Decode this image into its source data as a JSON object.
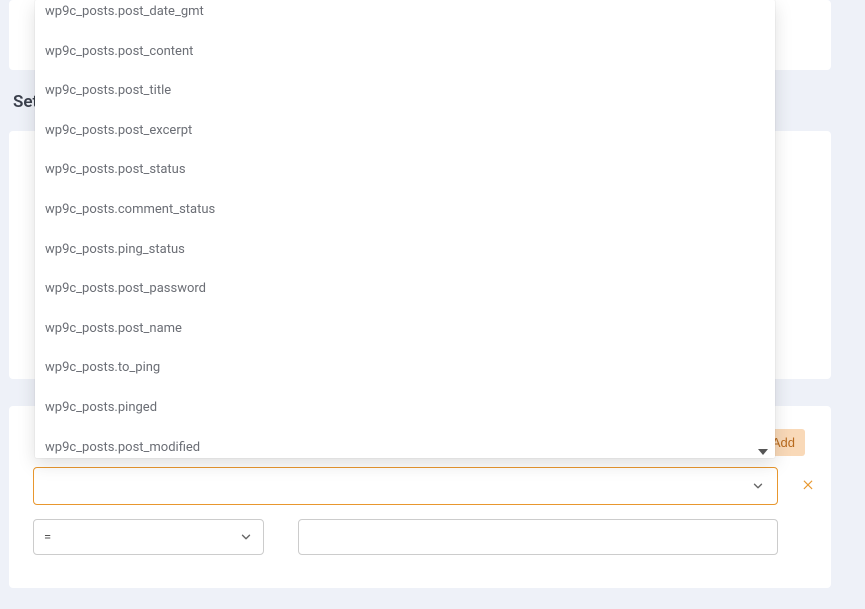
{
  "sectionLabel": "Set",
  "addButton": {
    "label": "Add"
  },
  "combo": {
    "value": ""
  },
  "operator": {
    "value": "="
  },
  "valueField": {
    "value": "",
    "placeholder": ""
  },
  "dropdown": {
    "items": [
      {
        "label": "wp9c_posts.post_date_gmt"
      },
      {
        "label": "wp9c_posts.post_content"
      },
      {
        "label": "wp9c_posts.post_title"
      },
      {
        "label": "wp9c_posts.post_excerpt"
      },
      {
        "label": "wp9c_posts.post_status"
      },
      {
        "label": "wp9c_posts.comment_status"
      },
      {
        "label": "wp9c_posts.ping_status"
      },
      {
        "label": "wp9c_posts.post_password"
      },
      {
        "label": "wp9c_posts.post_name"
      },
      {
        "label": "wp9c_posts.to_ping"
      },
      {
        "label": "wp9c_posts.pinged"
      },
      {
        "label": "wp9c_posts.post_modified"
      }
    ]
  }
}
